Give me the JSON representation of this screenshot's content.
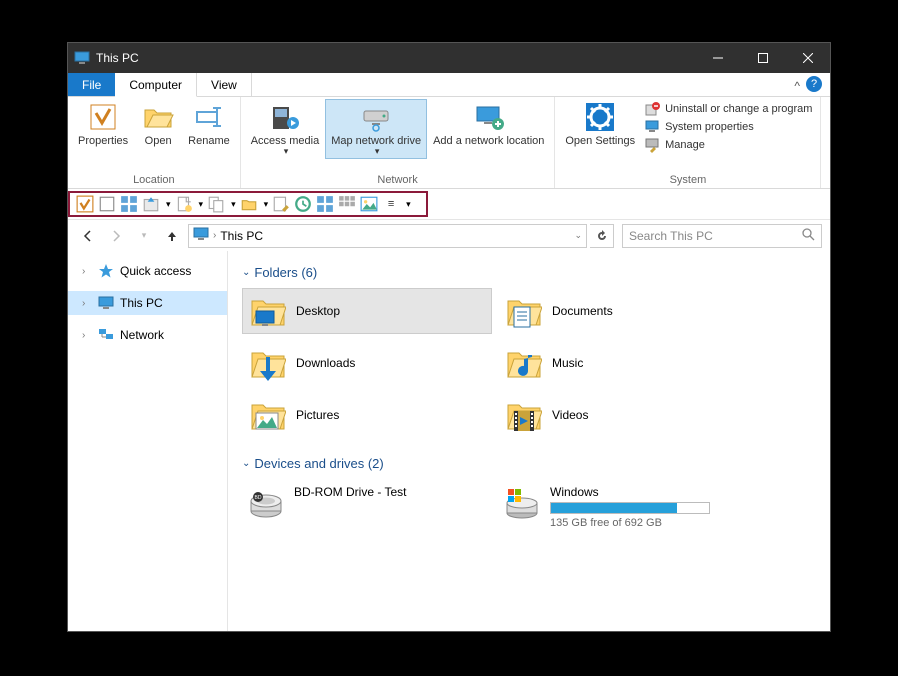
{
  "title": "This PC",
  "tabs": {
    "file": "File",
    "computer": "Computer",
    "view": "View"
  },
  "ribbon": {
    "location": {
      "label": "Location",
      "properties": "Properties",
      "open": "Open",
      "rename": "Rename"
    },
    "network": {
      "label": "Network",
      "access_media": "Access media",
      "map_network_drive": "Map network drive",
      "add_network_location": "Add a network location"
    },
    "system": {
      "label": "System",
      "open_settings": "Open Settings",
      "uninstall": "Uninstall or change a program",
      "sys_props": "System properties",
      "manage": "Manage"
    }
  },
  "breadcrumb": {
    "path": "This PC"
  },
  "search": {
    "placeholder": "Search This PC"
  },
  "sidebar": {
    "quick_access": "Quick access",
    "this_pc": "This PC",
    "network": "Network"
  },
  "folders": {
    "header": "Folders (6)",
    "items": [
      {
        "label": "Desktop",
        "overlay": "monitor",
        "selected": true
      },
      {
        "label": "Documents",
        "overlay": "doc"
      },
      {
        "label": "Downloads",
        "overlay": "arrow"
      },
      {
        "label": "Music",
        "overlay": "note"
      },
      {
        "label": "Pictures",
        "overlay": "pic"
      },
      {
        "label": "Videos",
        "overlay": "film"
      }
    ]
  },
  "drives": {
    "header": "Devices and drives (2)",
    "items": [
      {
        "label": "BD-ROM Drive - Test",
        "type": "disc"
      },
      {
        "label": "Windows",
        "type": "hdd",
        "gauge_pct": 80,
        "sub": "135 GB free of 692 GB"
      }
    ]
  }
}
